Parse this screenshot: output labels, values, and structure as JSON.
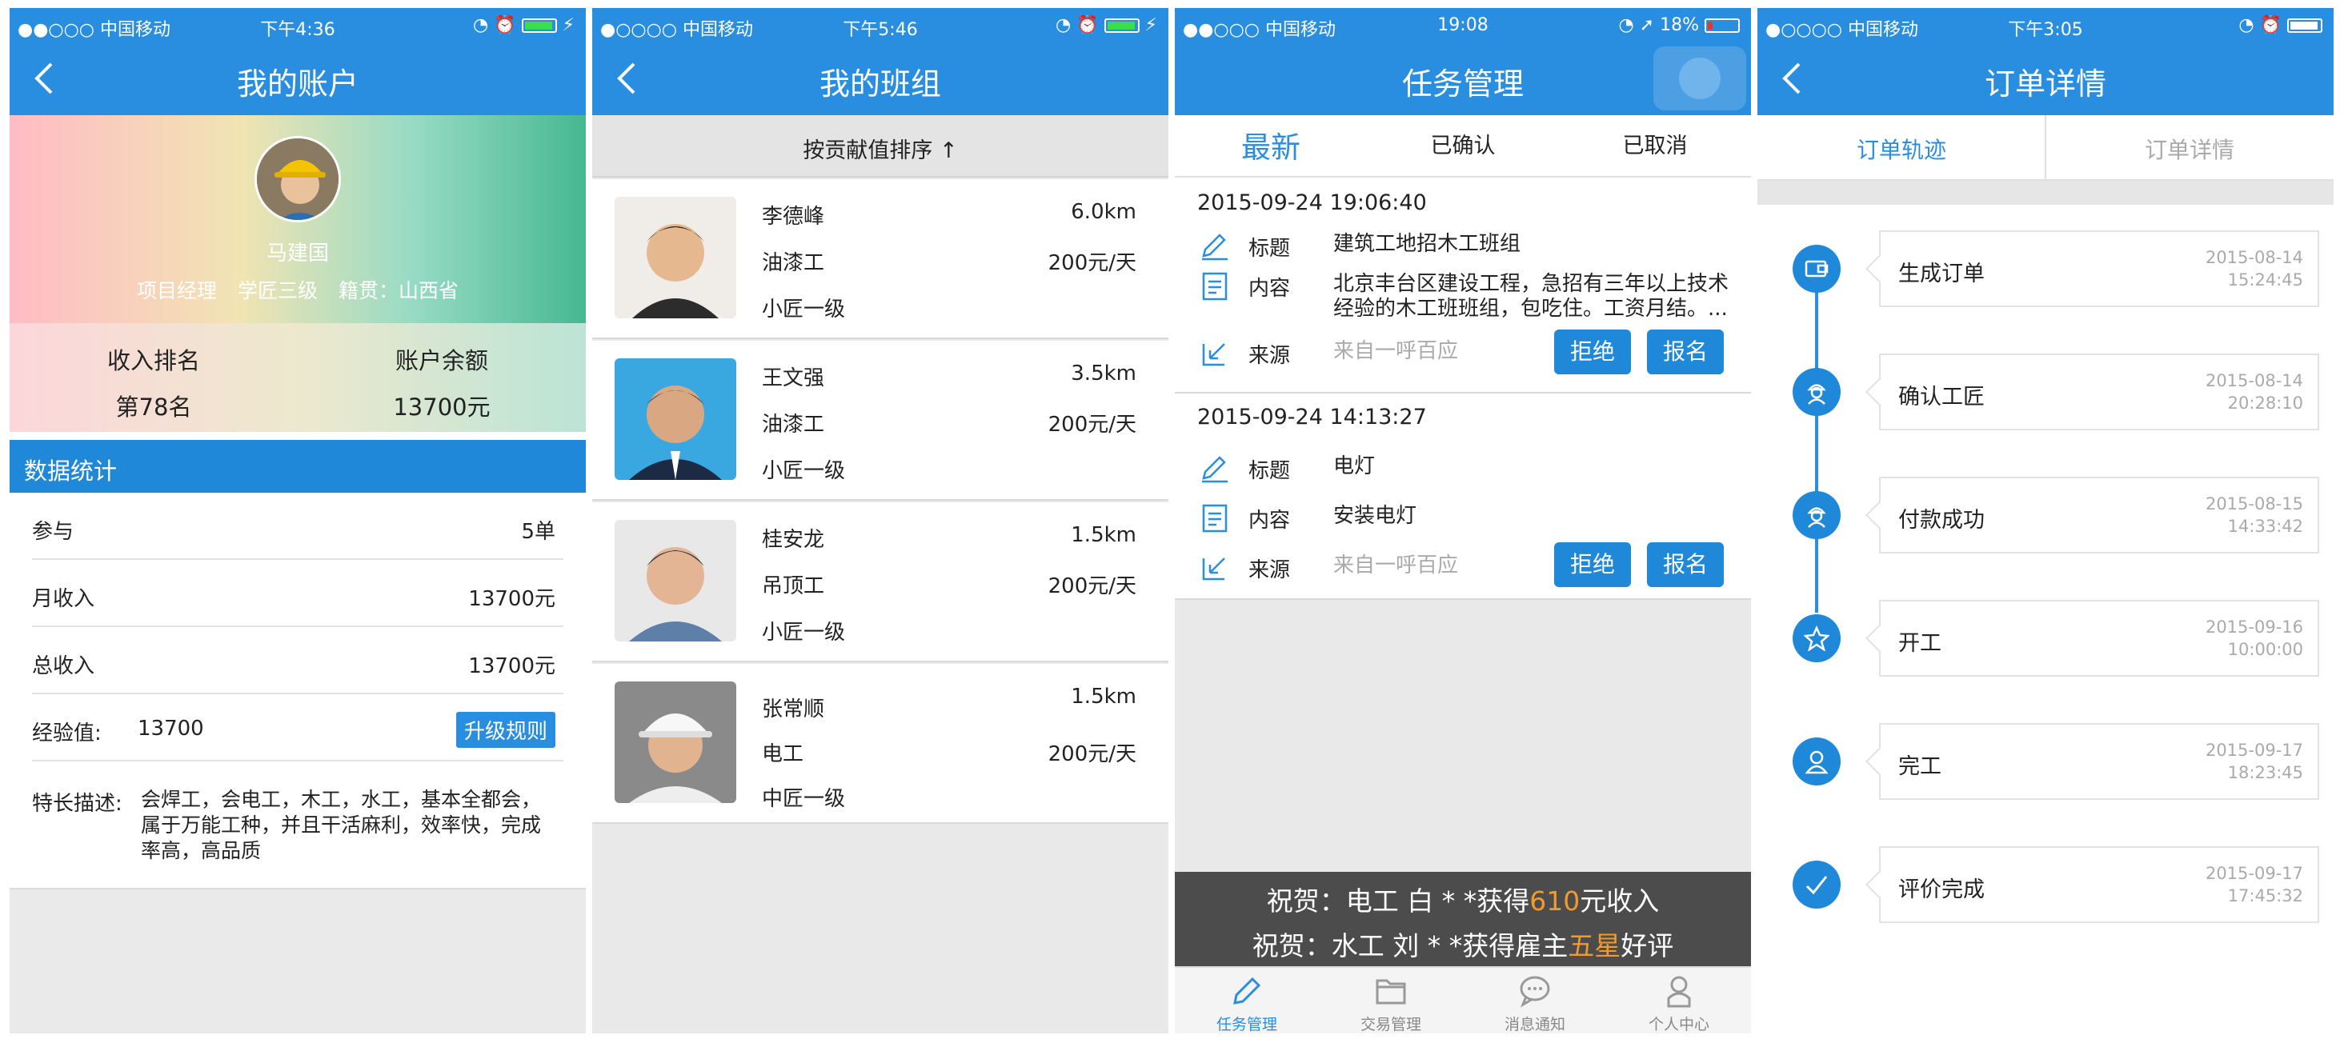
{
  "colors": {
    "primary": "#2a8ee0",
    "accent": "#f39a2a"
  },
  "s1": {
    "status": {
      "carrier": "●●○○○ 中国移动",
      "time": "下午4:36"
    },
    "title": "我的账户",
    "profile": {
      "name": "马建国",
      "meta": "项目经理 学匠三级 籍贯：山西省"
    },
    "stats": {
      "rank_label": "收入排名",
      "rank_value": "第78名",
      "balance_label": "账户余额",
      "balance_value": "13700元"
    },
    "section_title": "数据统计",
    "rows": [
      {
        "label": "参与",
        "value": "5单"
      },
      {
        "label": "月收入",
        "value": "13700元"
      },
      {
        "label": "总收入",
        "value": "13700元"
      }
    ],
    "exp": {
      "label": "经验值:",
      "value": "13700",
      "button": "升级规则"
    },
    "desc": {
      "label": "特长描述:",
      "text": "会焊工，会电工，木工，水工，基本全都会，属于万能工种，并且干活麻利，效率快，完成率高，高品质"
    }
  },
  "s2": {
    "status": {
      "carrier": "●○○○○ 中国移动",
      "time": "下午5:46"
    },
    "title": "我的班组",
    "sort_label": "按贡献值排序 ↑",
    "members": [
      {
        "name": "李德峰",
        "distance": "6.0km",
        "trade": "油漆工",
        "rate": "200元/天",
        "level": "小匠一级"
      },
      {
        "name": "王文强",
        "distance": "3.5km",
        "trade": "油漆工",
        "rate": "200元/天",
        "level": "小匠一级"
      },
      {
        "name": "桂安龙",
        "distance": "1.5km",
        "trade": "吊顶工",
        "rate": "200元/天",
        "level": "小匠一级"
      },
      {
        "name": "张常顺",
        "distance": "1.5km",
        "trade": "电工",
        "rate": "200元/天",
        "level": "中匠一级"
      }
    ]
  },
  "s3": {
    "status": {
      "carrier": "●●○○○ 中国移动",
      "time": "19:08",
      "battery": "18%"
    },
    "title": "任务管理",
    "tabs": [
      "最新",
      "已确认",
      "已取消"
    ],
    "field_labels": {
      "title": "标题",
      "content": "内容",
      "source": "来源"
    },
    "buttons": {
      "reject": "拒绝",
      "apply": "报名"
    },
    "tasks": [
      {
        "time": "2015-09-24 19:06:40",
        "title": "建筑工地招木工班组",
        "content": "北京丰台区建设工程，急招有三年以上技术经验的木工班班组，包吃住。工资月结。...",
        "source": "来自一呼百应"
      },
      {
        "time": "2015-09-24 14:13:27",
        "title": "电灯",
        "content": "安装电灯",
        "source": "来自一呼百应"
      }
    ],
    "ticker": [
      {
        "pre": "祝贺：电工 白 * *获得",
        "hl": "610",
        "post": "元收入"
      },
      {
        "pre": "祝贺：水工 刘 * *获得雇主",
        "hl": "五星",
        "post": "好评"
      }
    ],
    "tabbar": [
      "任务管理",
      "交易管理",
      "消息通知",
      "个人中心"
    ]
  },
  "s4": {
    "status": {
      "carrier": "●○○○○ 中国移动",
      "time": "下午3:05"
    },
    "title": "订单详情",
    "tabs": [
      "订单轨迹",
      "订单详情"
    ],
    "steps": [
      {
        "label": "生成订单",
        "date": "2015-08-14",
        "time": "15:24:45",
        "icon": "wallet-icon"
      },
      {
        "label": "确认工匠",
        "date": "2015-08-14",
        "time": "20:28:10",
        "icon": "worker-icon"
      },
      {
        "label": "付款成功",
        "date": "2015-08-15",
        "time": "14:33:42",
        "icon": "worker-icon"
      },
      {
        "label": "开工",
        "date": "2015-09-16",
        "time": "10:00:00",
        "icon": "star-icon"
      },
      {
        "label": "完工",
        "date": "2015-09-17",
        "time": "18:23:45",
        "icon": "person-icon"
      },
      {
        "label": "评价完成",
        "date": "2015-09-17",
        "time": "17:45:32",
        "icon": "check-icon"
      }
    ]
  }
}
